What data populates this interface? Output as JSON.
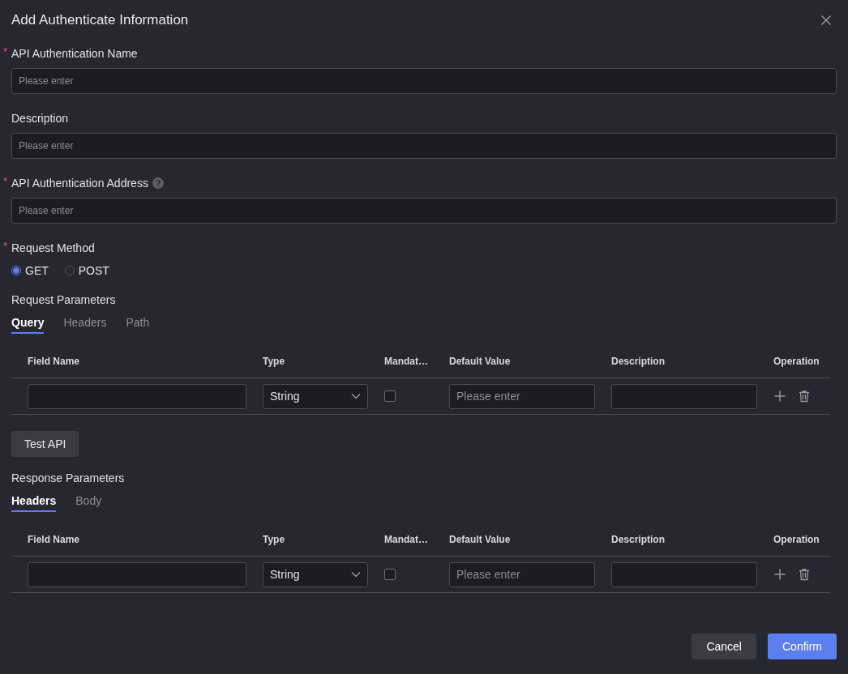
{
  "dialog": {
    "title": "Add Authenticate Information"
  },
  "fields": [
    {
      "required_mark": "*",
      "label": "API Authentication Name",
      "help": false,
      "placeholder": "Please enter"
    },
    {
      "label": "Description",
      "help": false,
      "placeholder": "Please enter"
    },
    {
      "required_mark": "*",
      "label": "API Authentication Address",
      "help": true,
      "placeholder": "Please enter"
    }
  ],
  "request_method": {
    "required_mark": "*",
    "label": "Request Method",
    "options": [
      {
        "label": "GET",
        "selected": true
      },
      {
        "label": "POST",
        "selected": false
      }
    ]
  },
  "request_parameters": {
    "label": "Request Parameters",
    "tabs": [
      {
        "label": "Query",
        "selected": true
      },
      {
        "label": "Headers",
        "selected": false
      },
      {
        "label": "Path",
        "selected": false
      }
    ],
    "columns": [
      "Field Name",
      "Type",
      "Mandat…",
      "Default Value",
      "Description",
      "Operation"
    ],
    "rows": [
      {
        "type": "String",
        "mandatory": false,
        "default_placeholder": "Please enter"
      }
    ]
  },
  "test_button": "Test API",
  "response_parameters": {
    "label": "Response Parameters",
    "tabs": [
      {
        "label": "Headers",
        "selected": true
      },
      {
        "label": "Body",
        "selected": false
      }
    ],
    "columns": [
      "Field Name",
      "Type",
      "Mandat…",
      "Default Value",
      "Description",
      "Operation"
    ],
    "rows": [
      {
        "type": "String",
        "mandatory": false,
        "default_placeholder": "Please enter"
      }
    ]
  },
  "buttons": [
    {
      "label": "Cancel",
      "kind": "secondary"
    },
    {
      "label": "Confirm",
      "kind": "primary"
    }
  ]
}
